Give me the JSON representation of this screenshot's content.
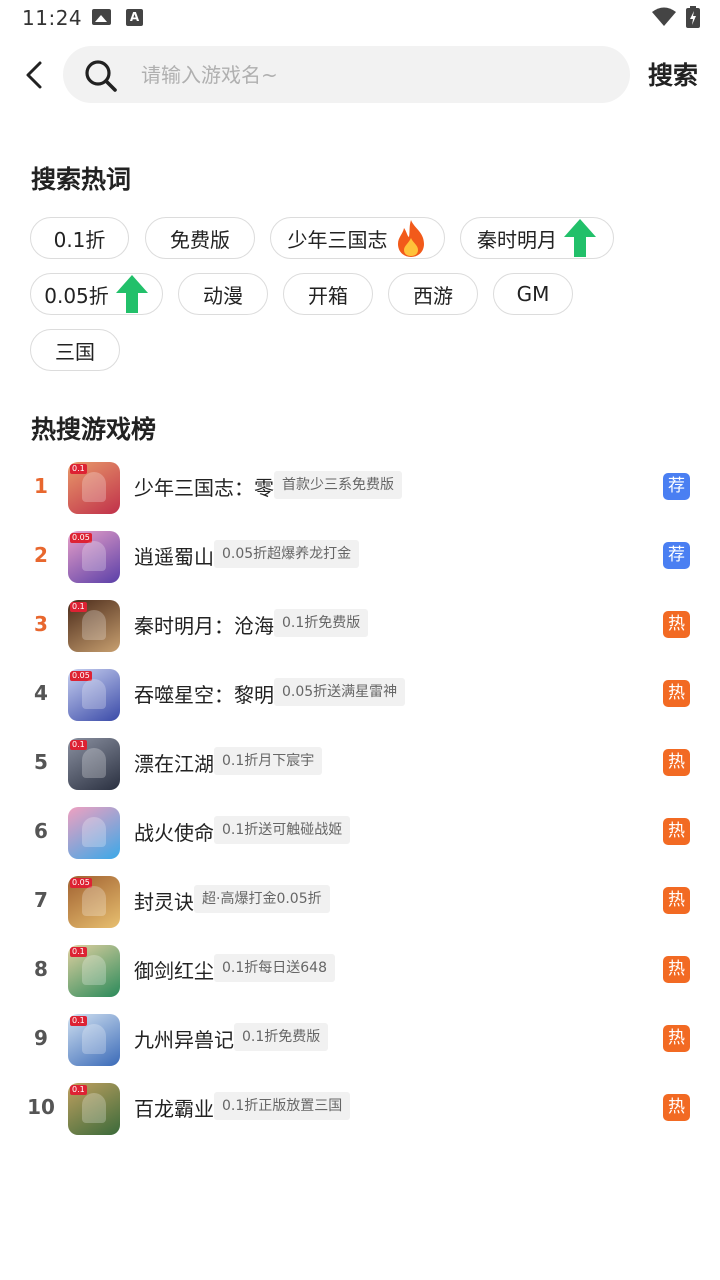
{
  "status_bar": {
    "time": "11:24",
    "icons": [
      "image-icon",
      "a-icon",
      "wifi-icon",
      "battery-icon"
    ]
  },
  "header": {
    "search_placeholder": "请输入游戏名~",
    "search_button": "搜索"
  },
  "hot_words": {
    "title": "搜索热词",
    "chips": [
      {
        "label": "0.1折",
        "icon": ""
      },
      {
        "label": "免费版",
        "icon": ""
      },
      {
        "label": "少年三国志",
        "icon": "fire-icon"
      },
      {
        "label": "秦时明月",
        "icon": "arrow-up-icon"
      },
      {
        "label": "0.05折",
        "icon": "arrow-up-icon"
      },
      {
        "label": "动漫",
        "icon": ""
      },
      {
        "label": "开箱",
        "icon": ""
      },
      {
        "label": "西游",
        "icon": ""
      },
      {
        "label": "GM",
        "icon": ""
      },
      {
        "label": "三国",
        "icon": ""
      }
    ]
  },
  "ranking": {
    "title": "热搜游戏榜",
    "items": [
      {
        "rank": "1",
        "name": "少年三国志：零",
        "tag": "首款少三系免费版",
        "badge": "荐",
        "badge_type": "recommend",
        "icon_badge": "0.1",
        "icon_colors": [
          "#c0304a",
          "#e89a6a"
        ]
      },
      {
        "rank": "2",
        "name": "逍遥蜀山",
        "tag": "0.05折超爆养龙打金",
        "badge": "荐",
        "badge_type": "recommend",
        "icon_badge": "0.05",
        "icon_colors": [
          "#5a3fa8",
          "#e8a0c8"
        ]
      },
      {
        "rank": "3",
        "name": "秦时明月：沧海",
        "tag": "0.1折免费版",
        "badge": "热",
        "badge_type": "hot",
        "icon_badge": "0.1",
        "icon_colors": [
          "#c8a070",
          "#4a2a1a"
        ]
      },
      {
        "rank": "4",
        "name": "吞噬星空：黎明",
        "tag": "0.05折送满星雷神",
        "badge": "热",
        "badge_type": "hot",
        "icon_badge": "0.05",
        "icon_colors": [
          "#3a4aa8",
          "#c8d0f0"
        ]
      },
      {
        "rank": "5",
        "name": "漂在江湖",
        "tag": "0.1折月下宸宇",
        "badge": "热",
        "badge_type": "hot",
        "icon_badge": "0.1",
        "icon_colors": [
          "#2a3040",
          "#8a90a0"
        ]
      },
      {
        "rank": "6",
        "name": "战火使命",
        "tag": "0.1折送可触碰战姬",
        "badge": "热",
        "badge_type": "hot",
        "icon_badge": "",
        "icon_colors": [
          "#3aa8e8",
          "#f0a0c0"
        ]
      },
      {
        "rank": "7",
        "name": "封灵诀",
        "tag": "超·高爆打金0.05折",
        "badge": "热",
        "badge_type": "hot",
        "icon_badge": "0.05",
        "icon_colors": [
          "#e8c070",
          "#a06030"
        ]
      },
      {
        "rank": "8",
        "name": "御剑红尘",
        "tag": "0.1折每日送648",
        "badge": "热",
        "badge_type": "hot",
        "icon_badge": "0.1",
        "icon_colors": [
          "#2a8a5a",
          "#e0d0a0"
        ]
      },
      {
        "rank": "9",
        "name": "九州异兽记",
        "tag": "0.1折免费版",
        "badge": "热",
        "badge_type": "hot",
        "icon_badge": "0.1",
        "icon_colors": [
          "#3a6ab8",
          "#d0e0f0"
        ]
      },
      {
        "rank": "10",
        "name": "百龙霸业",
        "tag": "0.1折正版放置三国",
        "badge": "热",
        "badge_type": "hot",
        "icon_badge": "0.1",
        "icon_colors": [
          "#3a6a3a",
          "#c0a060"
        ]
      }
    ]
  },
  "colors": {
    "accent_rank": "#e8672e",
    "recommend_badge": "#4a7ff2",
    "hot_badge": "#f26a23",
    "arrow_up": "#22c06a",
    "fire": "#f25a1a"
  }
}
